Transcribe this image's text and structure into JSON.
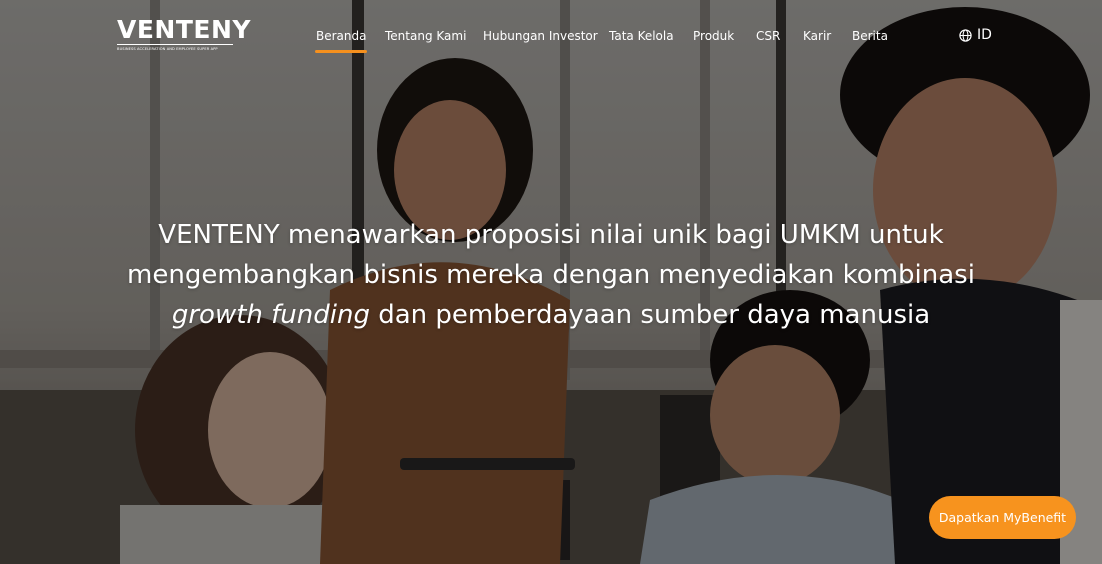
{
  "brand": {
    "name": "VENTENY",
    "tagline": "BUSINESS ACCELERATION AND EMPLOYEE SUPER APP"
  },
  "nav": {
    "items": [
      {
        "label": "Beranda",
        "active": true
      },
      {
        "label": "Tentang Kami",
        "active": false
      },
      {
        "label": "Hubungan Investor",
        "active": false
      },
      {
        "label": "Tata Kelola",
        "active": false
      },
      {
        "label": "Produk",
        "active": false
      },
      {
        "label": "CSR",
        "active": false
      },
      {
        "label": "Karir",
        "active": false
      },
      {
        "label": "Berita",
        "active": false
      }
    ],
    "language": "ID",
    "language_icon": "globe-icon"
  },
  "hero": {
    "headline_before": "VENTENY menawarkan proposisi nilai unik bagi UMKM untuk mengembangkan bisnis mereka dengan menyediakan kombinasi ",
    "headline_emphasis": "growth funding",
    "headline_after": " dan pemberdayaan sumber daya manusia"
  },
  "cta": {
    "label": "Dapatkan MyBenefit"
  },
  "colors": {
    "accent": "#f7931e",
    "text": "#ffffff"
  }
}
